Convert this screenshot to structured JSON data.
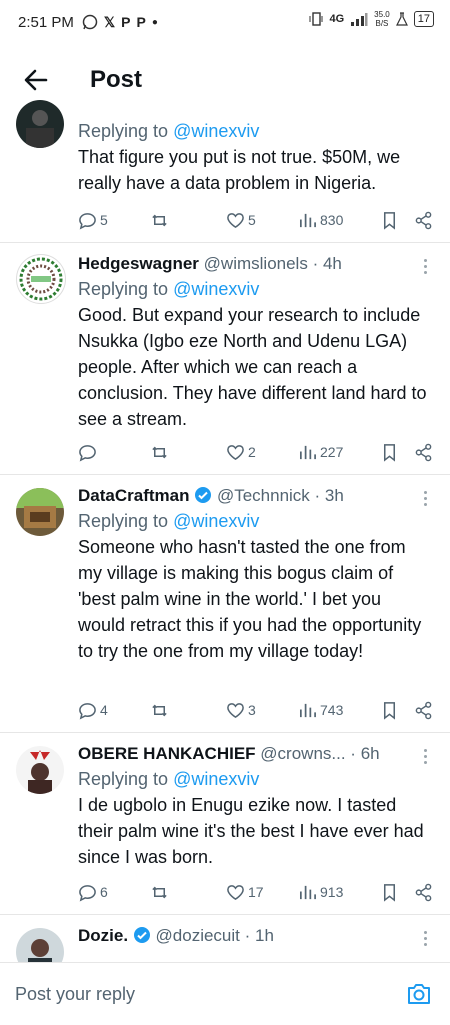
{
  "status": {
    "time": "2:51 PM",
    "icons": [
      "whatsapp-icon",
      "x-icon",
      "p-icon",
      "p-icon",
      "dot"
    ],
    "network": "4G",
    "speed": "35.0",
    "speed_unit": "B/S",
    "battery": "17"
  },
  "header": {
    "title": "Post"
  },
  "tweets": [
    {
      "name": "",
      "handle": "",
      "time": "",
      "replying_prefix": "Replying to",
      "replying_to": "@winexviv",
      "text": "That figure you put is not true. $50M, we really have a data problem in Nigeria.",
      "replies": "5",
      "retweets": "",
      "likes": "5",
      "views": "830"
    },
    {
      "name": "Hedgeswagner",
      "handle": "@wimslionels",
      "time": "4h",
      "replying_prefix": "Replying to",
      "replying_to": "@winexviv",
      "text": "Good. But expand your research to include Nsukka (Igbo eze North and Udenu LGA) people. After which we can reach a conclusion. They have different land hard to see a stream.",
      "replies": "",
      "retweets": "",
      "likes": "2",
      "views": "227"
    },
    {
      "name": "DataCraftman",
      "handle": "@Technnick",
      "time": "3h",
      "verified": true,
      "replying_prefix": "Replying to",
      "replying_to": "@winexviv",
      "text": "Someone who hasn't tasted the one from my village is making this bogus claim of 'best palm wine in the world.' I bet you would retract this if you had the opportunity to try the one from my village today!",
      "replies": "4",
      "retweets": "",
      "likes": "3",
      "views": "743"
    },
    {
      "name": "OBERE HANKACHIEF",
      "handle": "@crowns...",
      "time": "6h",
      "replying_prefix": "Replying to",
      "replying_to": "@winexviv",
      "text": "I de ugbolo in Enugu ezike now.  I tasted their palm wine it's the best I have ever had since I was born.",
      "replies": "6",
      "retweets": "",
      "likes": "17",
      "views": "913"
    },
    {
      "name": "Dozie.",
      "handle": "@doziecuit",
      "time": "1h",
      "verified": true
    }
  ],
  "reply_bar": {
    "placeholder": "Post your reply"
  },
  "colors": {
    "link": "#1d9bf0",
    "muted": "#536471"
  }
}
